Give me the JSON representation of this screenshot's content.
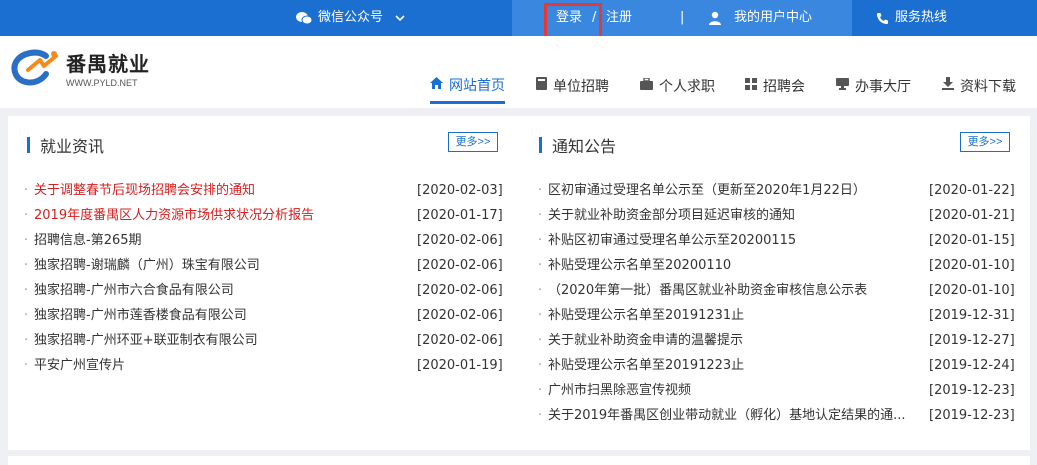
{
  "topbar": {
    "wechat_label": "微信公众号",
    "login": "登录",
    "slash": "/",
    "register": "注册",
    "separator": "|",
    "user_center": "我的用户中心",
    "hotline": "服务热线"
  },
  "logo": {
    "title": "番禺就业",
    "subtitle": "WWW.PYLD.NET"
  },
  "nav": [
    {
      "label": "网站首页",
      "icon": "home-icon"
    },
    {
      "label": "单位招聘",
      "icon": "book-icon"
    },
    {
      "label": "个人求职",
      "icon": "briefcase-icon"
    },
    {
      "label": "招聘会",
      "icon": "grid-icon"
    },
    {
      "label": "办事大厅",
      "icon": "computer-icon"
    },
    {
      "label": "资料下载",
      "icon": "download-icon"
    }
  ],
  "news": {
    "title": "就业资讯",
    "more": "更多>>",
    "items": [
      {
        "title": "关于调整春节后现场招聘会安排的通知",
        "date": "[2020-02-03]",
        "highlight": true
      },
      {
        "title": "2019年度番禺区人力资源市场供求状况分析报告",
        "date": "[2020-01-17]",
        "highlight": true
      },
      {
        "title": "招聘信息-第265期",
        "date": "[2020-02-06]",
        "highlight": false
      },
      {
        "title": "独家招聘-谢瑞麟（广州）珠宝有限公司",
        "date": "[2020-02-06]",
        "highlight": false
      },
      {
        "title": "独家招聘-广州市六合食品有限公司",
        "date": "[2020-02-06]",
        "highlight": false
      },
      {
        "title": "独家招聘-广州市莲香楼食品有限公司",
        "date": "[2020-02-06]",
        "highlight": false
      },
      {
        "title": "独家招聘-广州环亚+联亚制衣有限公司",
        "date": "[2020-02-06]",
        "highlight": false
      },
      {
        "title": "平安广州宣传片",
        "date": "[2020-01-19]",
        "highlight": false
      }
    ]
  },
  "notices": {
    "title": "通知公告",
    "more": "更多>>",
    "items": [
      {
        "title": "区初审通过受理名单公示至（更新至2020年1月22日）",
        "date": "[2020-01-22]"
      },
      {
        "title": "关于就业补助资金部分项目延迟审核的通知",
        "date": "[2020-01-21]"
      },
      {
        "title": "补贴区初审通过受理名单公示至20200115",
        "date": "[2020-01-15]"
      },
      {
        "title": "补贴受理公示名单至20200110",
        "date": "[2020-01-10]"
      },
      {
        "title": "（2020年第一批）番禺区就业补助资金审核信息公示表",
        "date": "[2020-01-10]"
      },
      {
        "title": "补贴受理公示名单至20191231止",
        "date": "[2019-12-31]"
      },
      {
        "title": "关于就业补助资金申请的温馨提示",
        "date": "[2019-12-27]"
      },
      {
        "title": "补贴受理公示名单至20191223止",
        "date": "[2019-12-24]"
      },
      {
        "title": "广州市扫黑除恶宣传视频",
        "date": "[2019-12-23]"
      },
      {
        "title": "关于2019年番禺区创业带动就业（孵化）基地认定结果的通...",
        "date": "[2019-12-23]"
      }
    ]
  },
  "colors": {
    "brand_blue": "#1a6fd1",
    "highlight_red": "#d32020",
    "login_box": "#e53935"
  }
}
